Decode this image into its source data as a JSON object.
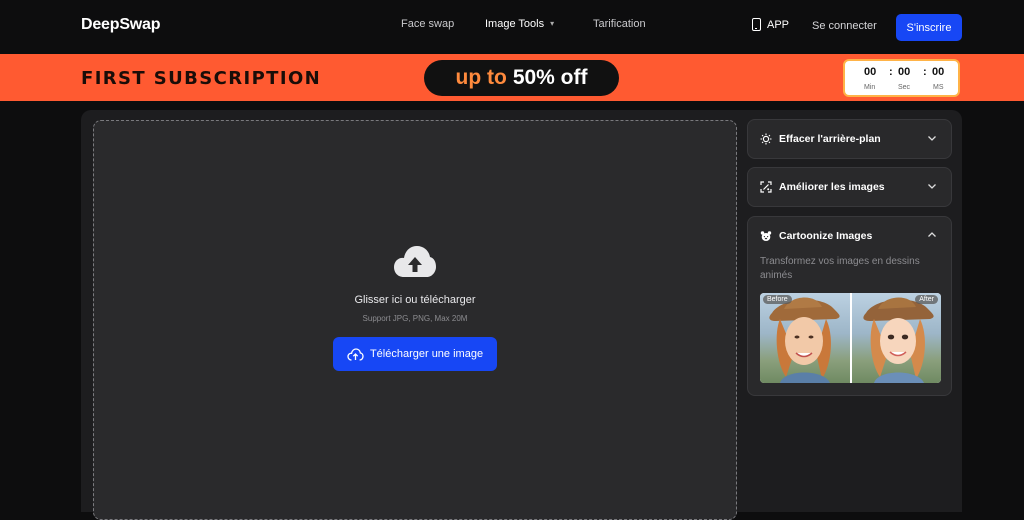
{
  "header": {
    "logo": "DeepSwap",
    "nav": [
      {
        "label": "Face swap"
      },
      {
        "label": "Image Tools"
      },
      {
        "label": "Tarification"
      }
    ],
    "app_label": "APP",
    "login_label": "Se connecter",
    "signup_label": "S'inscrire"
  },
  "promo": {
    "title": "FIRST SUBSCRIPTION",
    "up_to": "up to",
    "discount": "50% off",
    "timer": {
      "min": "00",
      "sec": "00",
      "ms": "00",
      "min_label": "Min",
      "sec_label": "Sec",
      "ms_label": "MS"
    }
  },
  "upload": {
    "title": "Glisser ici ou télécharger",
    "support": "Support JPG, PNG, Max 20M",
    "button_label": "Télécharger une image"
  },
  "tools": {
    "items": [
      {
        "label": "Effacer l'arrière-plan",
        "icon": "sun-icon",
        "expanded": false
      },
      {
        "label": "Améliorer les images",
        "icon": "enhance-icon",
        "expanded": false
      },
      {
        "label": "Cartoonize Images",
        "icon": "bear-icon",
        "expanded": true,
        "description": "Transformez vos images en dessins animés",
        "before_label": "Before",
        "after_label": "After"
      }
    ]
  },
  "colors": {
    "accent": "#1747f5",
    "promo_bg": "#ff5a31",
    "promo_highlight": "#ff8a3d"
  }
}
